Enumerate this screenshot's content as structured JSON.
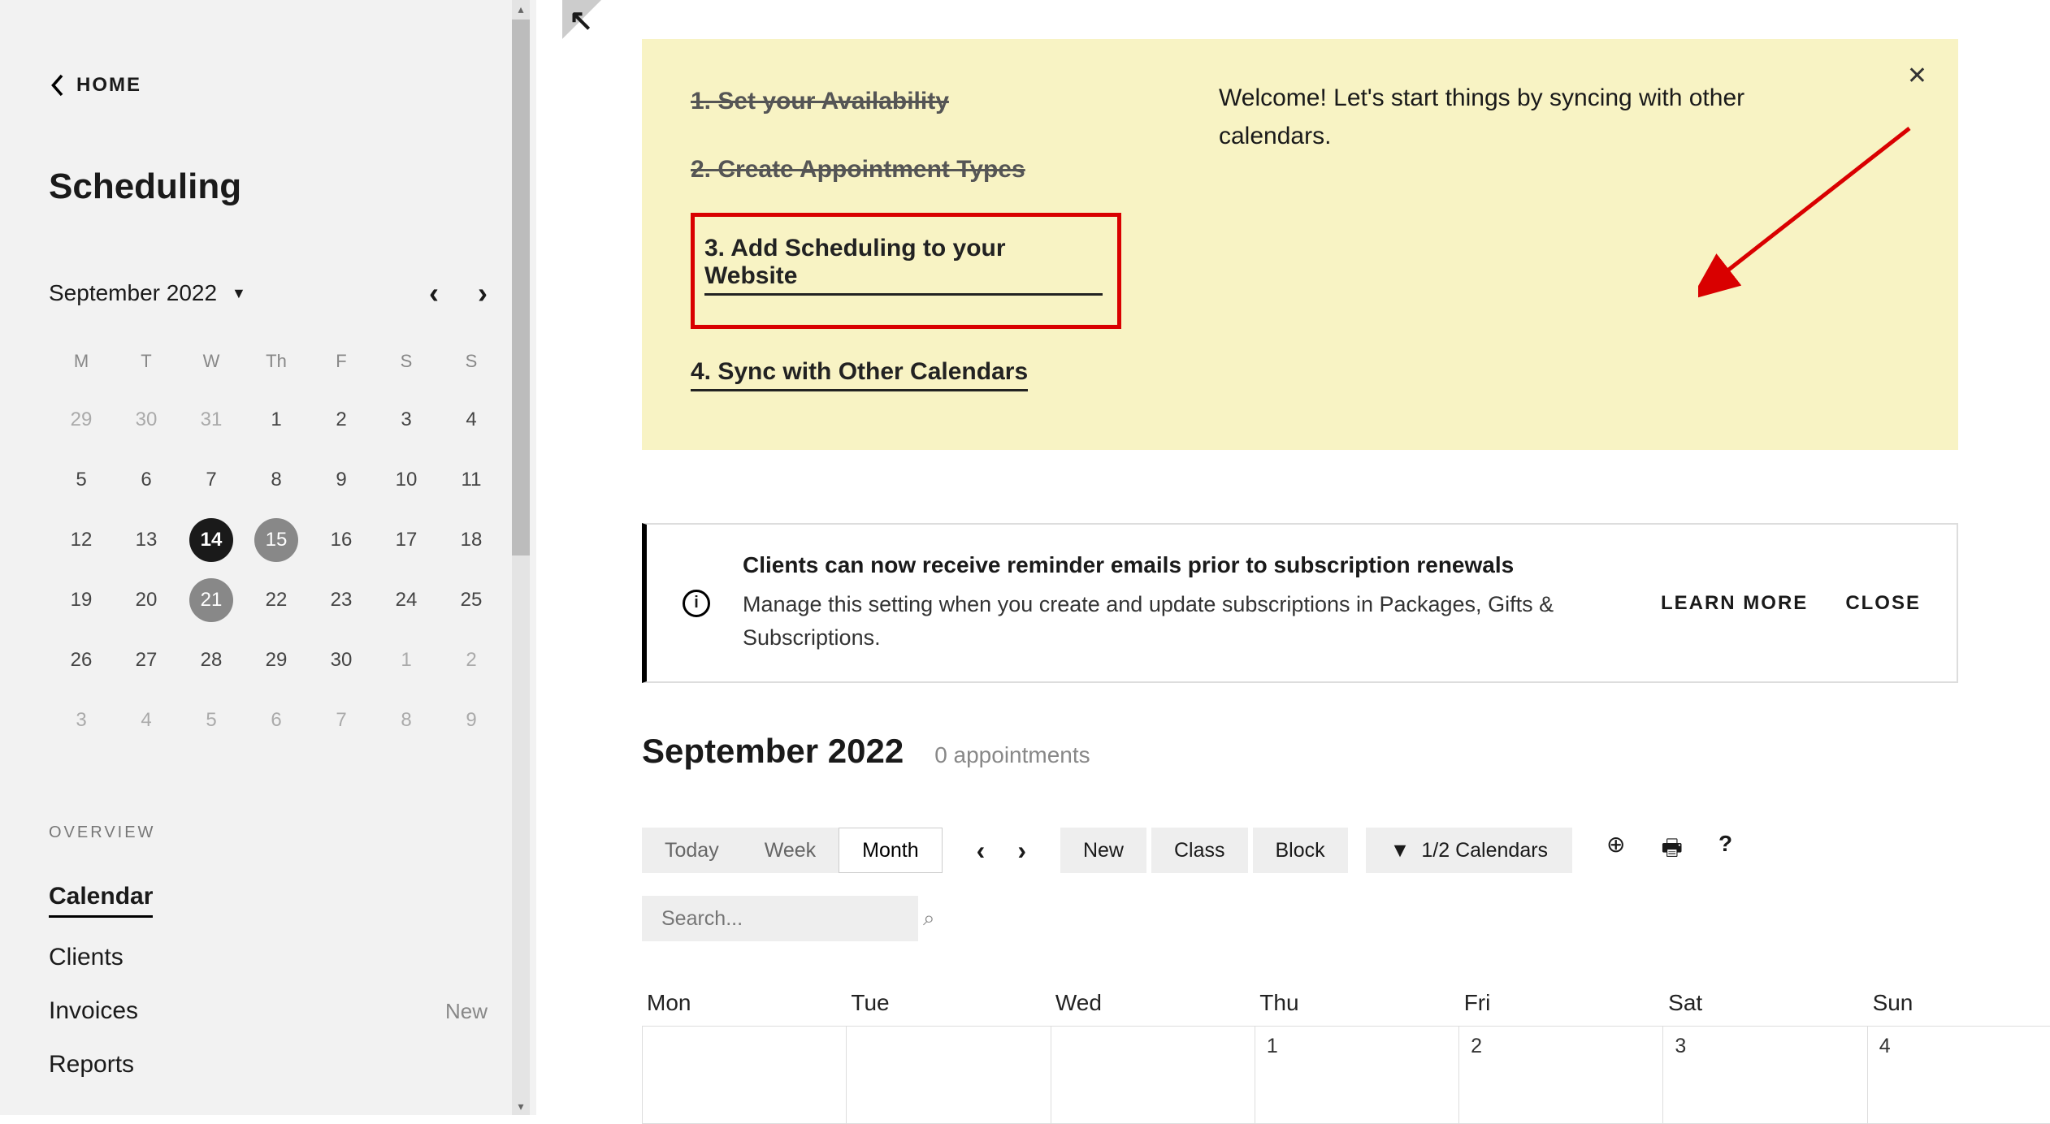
{
  "sidebar": {
    "home": "HOME",
    "title": "Scheduling",
    "month_label": "September 2022",
    "dow": [
      "M",
      "T",
      "W",
      "Th",
      "F",
      "S",
      "S"
    ],
    "days": [
      {
        "n": "29",
        "muted": true
      },
      {
        "n": "30",
        "muted": true
      },
      {
        "n": "31",
        "muted": true
      },
      {
        "n": "1"
      },
      {
        "n": "2"
      },
      {
        "n": "3"
      },
      {
        "n": "4"
      },
      {
        "n": "5"
      },
      {
        "n": "6"
      },
      {
        "n": "7"
      },
      {
        "n": "8"
      },
      {
        "n": "9"
      },
      {
        "n": "10"
      },
      {
        "n": "11"
      },
      {
        "n": "12"
      },
      {
        "n": "13"
      },
      {
        "n": "14",
        "today": true
      },
      {
        "n": "15",
        "sel": true
      },
      {
        "n": "16"
      },
      {
        "n": "17"
      },
      {
        "n": "18"
      },
      {
        "n": "19"
      },
      {
        "n": "20"
      },
      {
        "n": "21",
        "sel": true
      },
      {
        "n": "22"
      },
      {
        "n": "23"
      },
      {
        "n": "24"
      },
      {
        "n": "25"
      },
      {
        "n": "26"
      },
      {
        "n": "27"
      },
      {
        "n": "28"
      },
      {
        "n": "29"
      },
      {
        "n": "30"
      },
      {
        "n": "1",
        "muted": true
      },
      {
        "n": "2",
        "muted": true
      },
      {
        "n": "3",
        "muted": true
      },
      {
        "n": "4",
        "muted": true
      },
      {
        "n": "5",
        "muted": true
      },
      {
        "n": "6",
        "muted": true
      },
      {
        "n": "7",
        "muted": true
      },
      {
        "n": "8",
        "muted": true
      },
      {
        "n": "9",
        "muted": true
      }
    ],
    "overview_label": "OVERVIEW",
    "nav": [
      {
        "label": "Calendar",
        "active": true
      },
      {
        "label": "Clients"
      },
      {
        "label": "Invoices",
        "badge": "New"
      },
      {
        "label": "Reports"
      }
    ]
  },
  "banner": {
    "steps": [
      {
        "text": "1. Set your Availability",
        "done": true
      },
      {
        "text": "2. Create Appointment Types",
        "done": true
      },
      {
        "text": "3. Add Scheduling to your Website",
        "highlight": true,
        "link": true
      },
      {
        "text": "4. Sync with Other Calendars",
        "link": true
      }
    ],
    "message": "Welcome! Let's start things by syncing with other calendars."
  },
  "notice": {
    "title": "Clients can now receive reminder emails prior to subscription renewals",
    "body": "Manage this setting when you create and update subscriptions in Packages, Gifts & Subscriptions.",
    "learn": "LEARN MORE",
    "close": "CLOSE"
  },
  "calendar": {
    "heading": "September 2022",
    "count": "0 appointments",
    "views": {
      "today": "Today",
      "week": "Week",
      "month": "Month"
    },
    "buttons": {
      "new": "New",
      "class": "Class",
      "block": "Block"
    },
    "filter": "1/2 Calendars",
    "search_placeholder": "Search...",
    "dow": [
      "Mon",
      "Tue",
      "Wed",
      "Thu",
      "Fri",
      "Sat",
      "Sun"
    ],
    "row1": [
      "",
      "",
      "",
      "1",
      "2",
      "3",
      "4"
    ]
  }
}
